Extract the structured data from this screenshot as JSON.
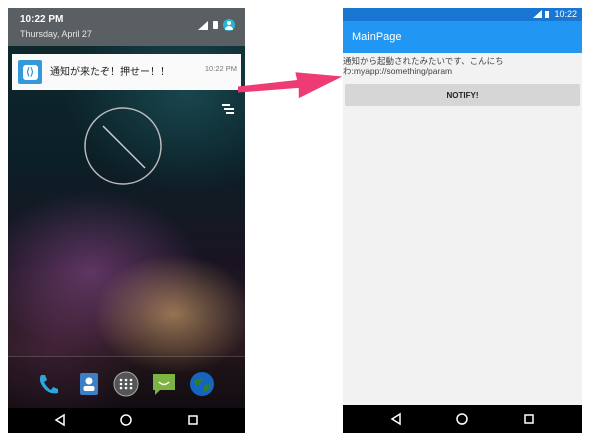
{
  "left_phone": {
    "status": {
      "time": "10:22 PM",
      "date": "Thursday, April 27"
    },
    "notification": {
      "title": "通知が来たぞ！押せー！！",
      "time": "10:22 PM",
      "app_icon": "xamarin-icon"
    },
    "dock_icons": [
      "phone-icon",
      "contacts-icon",
      "apps-icon",
      "messaging-icon",
      "browser-icon"
    ],
    "nav": [
      "back-icon",
      "home-icon",
      "recents-icon"
    ]
  },
  "right_phone": {
    "status": {
      "time": "10:22"
    },
    "app_title": "MainPage",
    "message": "通知から起動されたみたいです、こんにちわ:myapp://something/param",
    "notify_button": "NOTIFY!",
    "nav": [
      "back-icon",
      "home-icon",
      "recents-icon"
    ]
  },
  "colors": {
    "arrow": "#ee3b74",
    "app_bar": "#2196f3",
    "status_bar": "#1976d2"
  }
}
